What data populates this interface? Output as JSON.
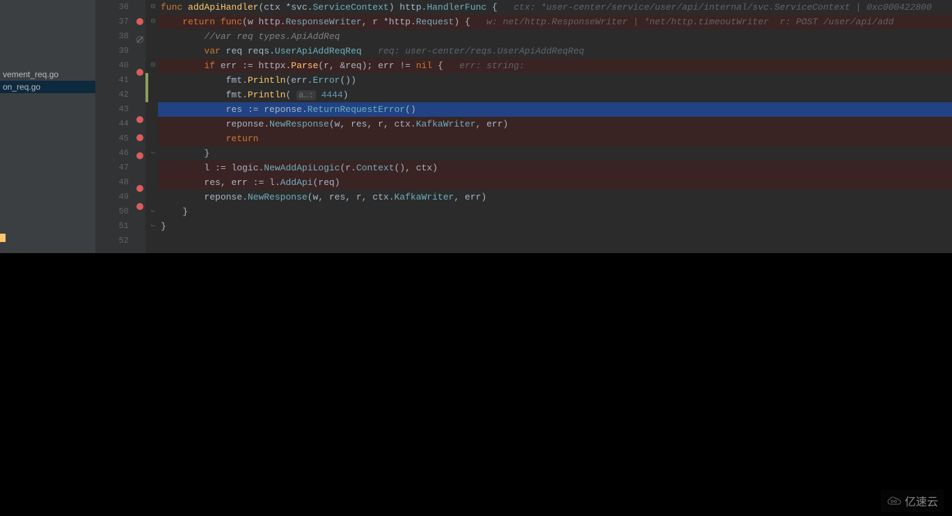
{
  "sidebar": {
    "files": [
      {
        "name": "vement_req.go",
        "selected": false
      },
      {
        "name": "on_req.go",
        "selected": true
      }
    ]
  },
  "gutter": {
    "start": 36,
    "end": 52
  },
  "breakpoints": {
    "37": "active",
    "38": "disabled",
    "40": "active",
    "43": "active",
    "44": "active",
    "45": "active",
    "47": "active",
    "48": "active"
  },
  "folds": {
    "36": "open-top",
    "37": "open",
    "40": "open",
    "46": "close",
    "50": "close",
    "51": "close"
  },
  "change_markers": {
    "41": "modified",
    "42": "modified"
  },
  "highlighted_line": 43,
  "code": {
    "36": {
      "tokens": [
        {
          "t": "kw",
          "v": "func "
        },
        {
          "t": "fn",
          "v": "addApiHandler"
        },
        {
          "t": "punc",
          "v": "(ctx *"
        },
        {
          "t": "ident",
          "v": "svc"
        },
        {
          "t": "punc",
          "v": "."
        },
        {
          "t": "ty",
          "v": "ServiceContext"
        },
        {
          "t": "punc",
          "v": ") "
        },
        {
          "t": "ident",
          "v": "http"
        },
        {
          "t": "punc",
          "v": "."
        },
        {
          "t": "ty",
          "v": "HandlerFunc"
        },
        {
          "t": "punc",
          "v": " {   "
        },
        {
          "t": "hint",
          "v": "ctx: *user-center/service/user/api/internal/svc.ServiceContext | 0xc000422800"
        }
      ],
      "indent": 0
    },
    "37": {
      "tokens": [
        {
          "t": "kw",
          "v": "return func"
        },
        {
          "t": "punc",
          "v": "(w "
        },
        {
          "t": "ident",
          "v": "http"
        },
        {
          "t": "punc",
          "v": "."
        },
        {
          "t": "ty",
          "v": "ResponseWriter"
        },
        {
          "t": "punc",
          "v": ", r *"
        },
        {
          "t": "ident",
          "v": "http"
        },
        {
          "t": "punc",
          "v": "."
        },
        {
          "t": "ty",
          "v": "Request"
        },
        {
          "t": "punc",
          "v": ") {   "
        },
        {
          "t": "hint",
          "v": "w: net/http.ResponseWriter | *net/http.timeoutWriter  r: POST /user/api/add"
        }
      ],
      "indent": 1
    },
    "38": {
      "tokens": [
        {
          "t": "cm",
          "v": "//var req types.ApiAddReq"
        }
      ],
      "indent": 2
    },
    "39": {
      "tokens": [
        {
          "t": "kw",
          "v": "var "
        },
        {
          "t": "ident",
          "v": "req "
        },
        {
          "t": "ident",
          "v": "reqs"
        },
        {
          "t": "punc",
          "v": "."
        },
        {
          "t": "ty",
          "v": "UserApiAddReqReq"
        },
        {
          "t": "punc",
          "v": "   "
        },
        {
          "t": "hint",
          "v": "req: user-center/reqs.UserApiAddReqReq"
        }
      ],
      "indent": 2
    },
    "40": {
      "tokens": [
        {
          "t": "kw",
          "v": "if "
        },
        {
          "t": "ident",
          "v": "err "
        },
        {
          "t": "punc",
          "v": ":= "
        },
        {
          "t": "ident",
          "v": "httpx"
        },
        {
          "t": "punc",
          "v": "."
        },
        {
          "t": "fn",
          "v": "Parse"
        },
        {
          "t": "punc",
          "v": "(r, &req); "
        },
        {
          "t": "ident",
          "v": "err "
        },
        {
          "t": "punc",
          "v": "!= "
        },
        {
          "t": "kw",
          "v": "nil"
        },
        {
          "t": "punc",
          "v": " {   "
        },
        {
          "t": "hint",
          "v": "err: string:"
        }
      ],
      "indent": 2
    },
    "41": {
      "tokens": [
        {
          "t": "ident",
          "v": "fmt"
        },
        {
          "t": "punc",
          "v": "."
        },
        {
          "t": "fn",
          "v": "Println"
        },
        {
          "t": "punc",
          "v": "(err."
        },
        {
          "t": "ty",
          "v": "Error"
        },
        {
          "t": "punc",
          "v": "())"
        }
      ],
      "indent": 3
    },
    "42": {
      "tokens": [
        {
          "t": "ident",
          "v": "fmt"
        },
        {
          "t": "punc",
          "v": "."
        },
        {
          "t": "fn",
          "v": "Println"
        },
        {
          "t": "punc",
          "v": "( "
        },
        {
          "t": "hint-box",
          "v": "a…:"
        },
        {
          "t": "punc",
          "v": " "
        },
        {
          "t": "num",
          "v": "4444"
        },
        {
          "t": "punc",
          "v": ")"
        }
      ],
      "indent": 3
    },
    "43": {
      "tokens": [
        {
          "t": "ident",
          "v": "res "
        },
        {
          "t": "punc",
          "v": ":= "
        },
        {
          "t": "ident",
          "v": "reponse"
        },
        {
          "t": "punc",
          "v": "."
        },
        {
          "t": "ty",
          "v": "ReturnRequestError"
        },
        {
          "t": "punc",
          "v": "()"
        }
      ],
      "indent": 3
    },
    "44": {
      "tokens": [
        {
          "t": "ident",
          "v": "reponse"
        },
        {
          "t": "punc",
          "v": "."
        },
        {
          "t": "ty",
          "v": "NewResponse"
        },
        {
          "t": "punc",
          "v": "(w, res, r, ctx."
        },
        {
          "t": "ty",
          "v": "KafkaWriter"
        },
        {
          "t": "punc",
          "v": ", err)"
        }
      ],
      "indent": 3
    },
    "45": {
      "tokens": [
        {
          "t": "kw",
          "v": "return"
        }
      ],
      "indent": 3
    },
    "46": {
      "tokens": [
        {
          "t": "punc",
          "v": "}"
        }
      ],
      "indent": 2
    },
    "47": {
      "tokens": [
        {
          "t": "ident",
          "v": "l "
        },
        {
          "t": "punc",
          "v": ":= "
        },
        {
          "t": "ident",
          "v": "logic"
        },
        {
          "t": "punc",
          "v": "."
        },
        {
          "t": "ty",
          "v": "NewAddApiLogic"
        },
        {
          "t": "punc",
          "v": "(r."
        },
        {
          "t": "ty",
          "v": "Context"
        },
        {
          "t": "punc",
          "v": "(), ctx)"
        }
      ],
      "indent": 2
    },
    "48": {
      "tokens": [
        {
          "t": "ident",
          "v": "res"
        },
        {
          "t": "punc",
          "v": ", err "
        },
        {
          "t": "punc",
          "v": ":= "
        },
        {
          "t": "ident",
          "v": "l"
        },
        {
          "t": "punc",
          "v": "."
        },
        {
          "t": "ty",
          "v": "AddApi"
        },
        {
          "t": "punc",
          "v": "(req)"
        }
      ],
      "indent": 2
    },
    "49": {
      "tokens": [
        {
          "t": "ident",
          "v": "reponse"
        },
        {
          "t": "punc",
          "v": "."
        },
        {
          "t": "ty",
          "v": "NewResponse"
        },
        {
          "t": "punc",
          "v": "(w, res, r, ctx."
        },
        {
          "t": "ty",
          "v": "KafkaWriter"
        },
        {
          "t": "punc",
          "v": ", err)"
        }
      ],
      "indent": 2
    },
    "50": {
      "tokens": [
        {
          "t": "punc",
          "v": "}"
        }
      ],
      "indent": 1
    },
    "51": {
      "tokens": [
        {
          "t": "punc",
          "v": "}"
        }
      ],
      "indent": 0
    },
    "52": {
      "tokens": [],
      "indent": 0
    }
  },
  "watermark": "亿速云"
}
